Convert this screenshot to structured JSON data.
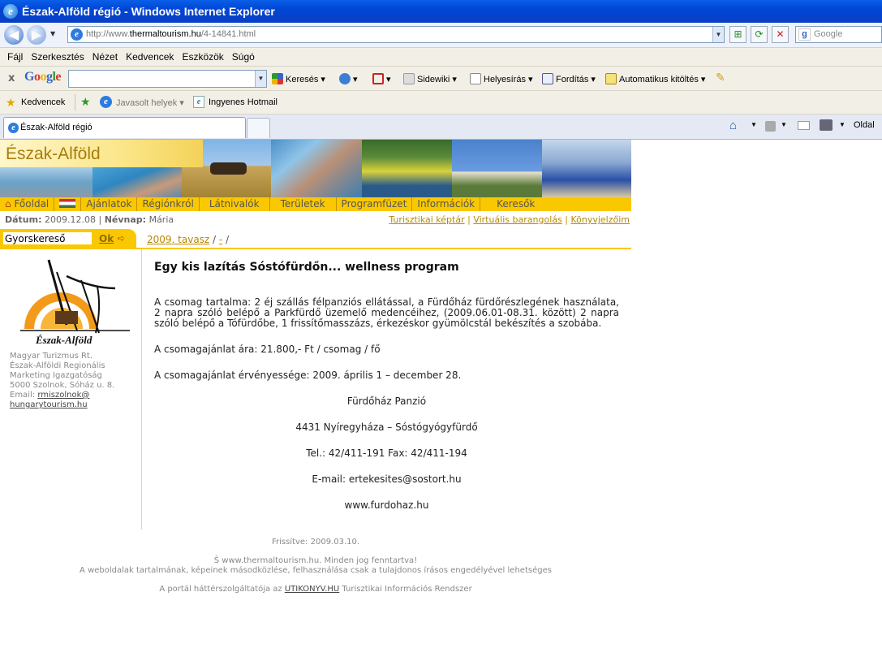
{
  "browser": {
    "title": "Észak-Alföld régió - Windows Internet Explorer",
    "url_prefix": "http://www.",
    "url_domain": "thermaltourism.hu",
    "url_path": "/4-14841.html",
    "search_placeholder": "Google",
    "menu": [
      "Fájl",
      "Szerkesztés",
      "Nézet",
      "Kedvencek",
      "Eszközök",
      "Súgó"
    ],
    "google_toolbar": {
      "logo": "Google",
      "search_label": "Keresés",
      "sidewiki": "Sidewiki",
      "spell": "Helyesírás",
      "translate": "Fordítás",
      "autofill": "Automatikus kitöltés"
    },
    "favorites": {
      "label": "Kedvencek",
      "suggested": "Javasolt helyek",
      "hotmail": "Ingyenes Hotmail"
    },
    "tab_title": "Észak-Alföld régió",
    "page_menu": "Oldal"
  },
  "site": {
    "name": "Észak-Alföld",
    "nav": [
      "Főoldal",
      "Ajánlatok",
      "Régiónkról",
      "Látnivalók",
      "Területek",
      "Programfüzet",
      "Információk",
      "Keresők"
    ],
    "date_label": "Dátum:",
    "date_value": "2009.12.08",
    "nameday_label": "Névnap:",
    "nameday_value": "Mária",
    "top_links": [
      "Turisztikai képtár",
      "Virtuális barangolás",
      "Könyvjelzőim"
    ],
    "quicksearch_value": "Gyorskereső",
    "ok_label": "Ok",
    "breadcrumb_link": "2009. tavasz",
    "breadcrumb_sep": " / ",
    "breadcrumb_dash": "-",
    "breadcrumb_end": " /",
    "logo_caption": "Észak-Alföld",
    "org_lines": [
      "Magyar Turizmus Rt.",
      "Észak-Alföldi Regionális",
      "Marketing Igazgatóság",
      "5000 Szolnok, Sóház u. 8."
    ],
    "email_label": "Email:",
    "email_line1": "rmiszolnok@",
    "email_line2": "hungarytourism.hu"
  },
  "article": {
    "title": "Egy kis lazítás Sóstófürdőn... wellness program",
    "p1": "A csomag tartalma: 2 éj szállás félpanziós ellátással, a Fürdőház fürdőrészlegének használata, 2 napra szóló belépő a Parkfürdő üzemelő medencéihez, (2009.06.01-08.31. között) 2 napra szóló belépő a Tófürdőbe, 1 frissítőmasszázs, érkezéskor gyümölcstál bekészítés a szobába.",
    "p2": "A csomagajánlat ára: 21.800,- Ft / csomag / fő",
    "p3": "A csomagajánlat érvényessége: 2009. április 1 – december 28.",
    "c1": "Fürdőház Panzió",
    "c2": "4431 Nyíregyháza – Sóstógyógyfürdő",
    "c3": "Tel.: 42/411-191 Fax: 42/411-194",
    "c4": "E-mail: ertekesites@sostort.hu",
    "c5": "www.furdohaz.hu"
  },
  "footer": {
    "updated": "Frissítve: 2009.03.10.",
    "copyright": "Š www.thermaltourism.hu. Minden jog fenntartva!",
    "notice": "A weboldalak tartalmának, képeinek másodközlése, felhasználása csak a tulajdonos írásos engedélyével lehetséges",
    "portal_pre": "A portál háttérszolgáltatója az ",
    "portal_link": "UTIKONYV.HU",
    "portal_post": " Turisztikai Információs Rendszer"
  }
}
